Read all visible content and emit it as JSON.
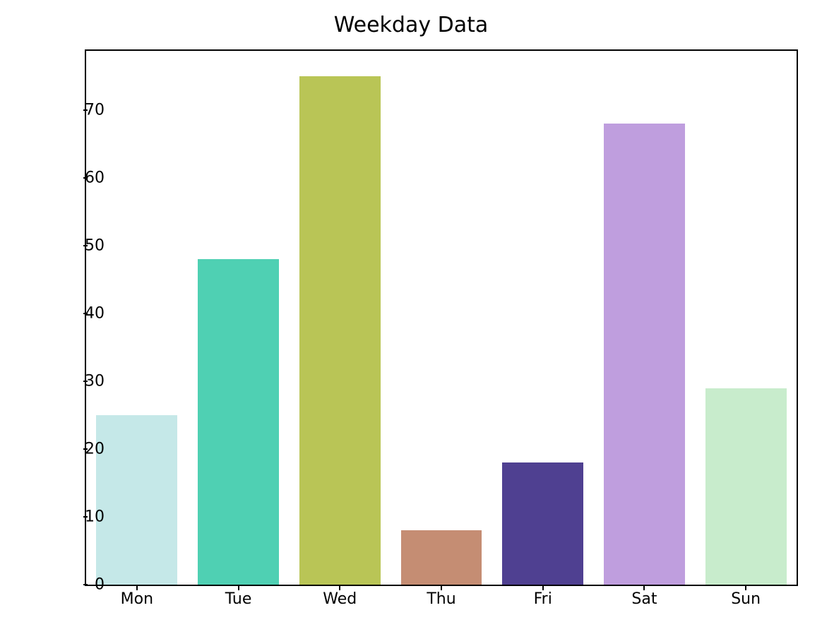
{
  "chart_data": {
    "type": "bar",
    "title": "Weekday Data",
    "xlabel": "",
    "ylabel": "",
    "categories": [
      "Mon",
      "Tue",
      "Wed",
      "Thu",
      "Fri",
      "Sat",
      "Sun"
    ],
    "values": [
      25,
      48,
      75,
      8,
      18,
      68,
      29
    ],
    "colors": [
      "#c5e8e8",
      "#4fd0b3",
      "#b9c556",
      "#c58d73",
      "#4f4091",
      "#bf9ede",
      "#c8eccc"
    ],
    "y_ticks": [
      0,
      10,
      20,
      30,
      40,
      50,
      60,
      70
    ],
    "ylim": [
      0,
      78.75
    ],
    "xlim": [
      -0.5,
      6.5
    ]
  }
}
